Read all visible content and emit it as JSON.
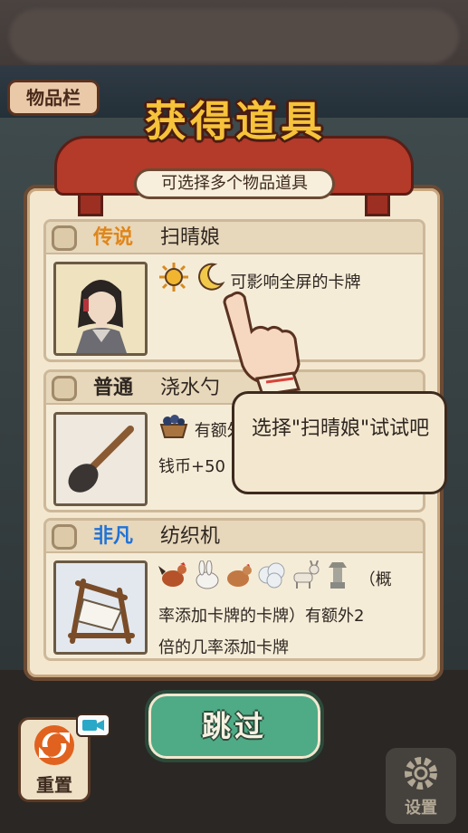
{
  "inventory_tab": {
    "label": "物品栏"
  },
  "dialog": {
    "title": "获得道具",
    "subtitle": "可选择多个物品道具"
  },
  "items": [
    {
      "rarity": "传说",
      "rarity_color": "#e0861a",
      "name": "扫晴娘",
      "icons": [
        "sun-icon",
        "moon-icon"
      ],
      "description": "可影响全屏的卡牌",
      "selected": false
    },
    {
      "rarity": "普通",
      "rarity_color": "#2e2620",
      "name": "浇水勺",
      "icons": [
        "coal-basket-icon"
      ],
      "description_line1": "有额外",
      "description_line2": "钱币+50",
      "selected": false
    },
    {
      "rarity": "非凡",
      "rarity_color": "#1e72d8",
      "name": "纺织机",
      "icons": [
        "rooster-icon",
        "rabbit-icon",
        "hen-icon",
        "cotton-icon",
        "goat-icon",
        "statue-icon"
      ],
      "description_line1": "（概",
      "description_line2": "率添加卡牌的卡牌）有额外2",
      "description_line3": "倍的几率添加卡牌",
      "selected": false
    }
  ],
  "tooltip": {
    "text": "选择\"扫晴娘\"试试吧"
  },
  "skip_button": {
    "label": "跳过"
  },
  "reset_button": {
    "label": "重置"
  },
  "settings_button": {
    "label": "设置"
  }
}
